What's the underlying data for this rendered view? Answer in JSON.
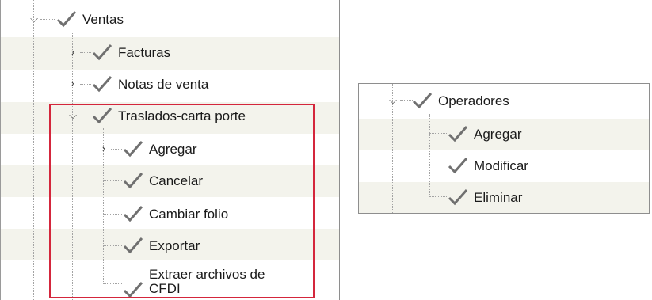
{
  "left_tree": {
    "root_label": "Ventas",
    "items": [
      {
        "label": "Facturas"
      },
      {
        "label": "Notas de venta"
      },
      {
        "label": "Traslados-carta porte"
      },
      {
        "label": "Agregar"
      },
      {
        "label": "Cancelar"
      },
      {
        "label": "Cambiar folio"
      },
      {
        "label": "Exportar"
      },
      {
        "label": "Extraer archivos de CFDI"
      }
    ]
  },
  "right_tree": {
    "root_label": "Operadores",
    "items": [
      {
        "label": "Agregar"
      },
      {
        "label": "Modificar"
      },
      {
        "label": "Eliminar"
      }
    ]
  },
  "colors": {
    "highlight_border": "#d4263c",
    "row_stripe": "#f3f3ec",
    "check": "#707070"
  },
  "icons": {
    "expanded": "chevron-down-icon",
    "collapsed": "chevron-right-icon",
    "checked": "checkmark-icon"
  }
}
